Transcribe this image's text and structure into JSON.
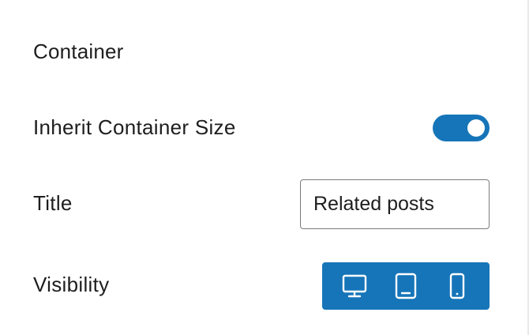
{
  "section": {
    "title": "Container"
  },
  "inherit_container_size": {
    "label": "Inherit Container Size",
    "enabled": true
  },
  "title_field": {
    "label": "Title",
    "value": "Related posts"
  },
  "visibility": {
    "label": "Visibility",
    "devices": [
      {
        "name": "desktop",
        "icon": "desktop-icon",
        "active": true
      },
      {
        "name": "tablet",
        "icon": "tablet-icon",
        "active": true
      },
      {
        "name": "mobile",
        "icon": "mobile-icon",
        "active": true
      }
    ]
  },
  "colors": {
    "accent": "#1675b8",
    "text": "#1e1e1e",
    "input_border": "#7b7b7b"
  }
}
